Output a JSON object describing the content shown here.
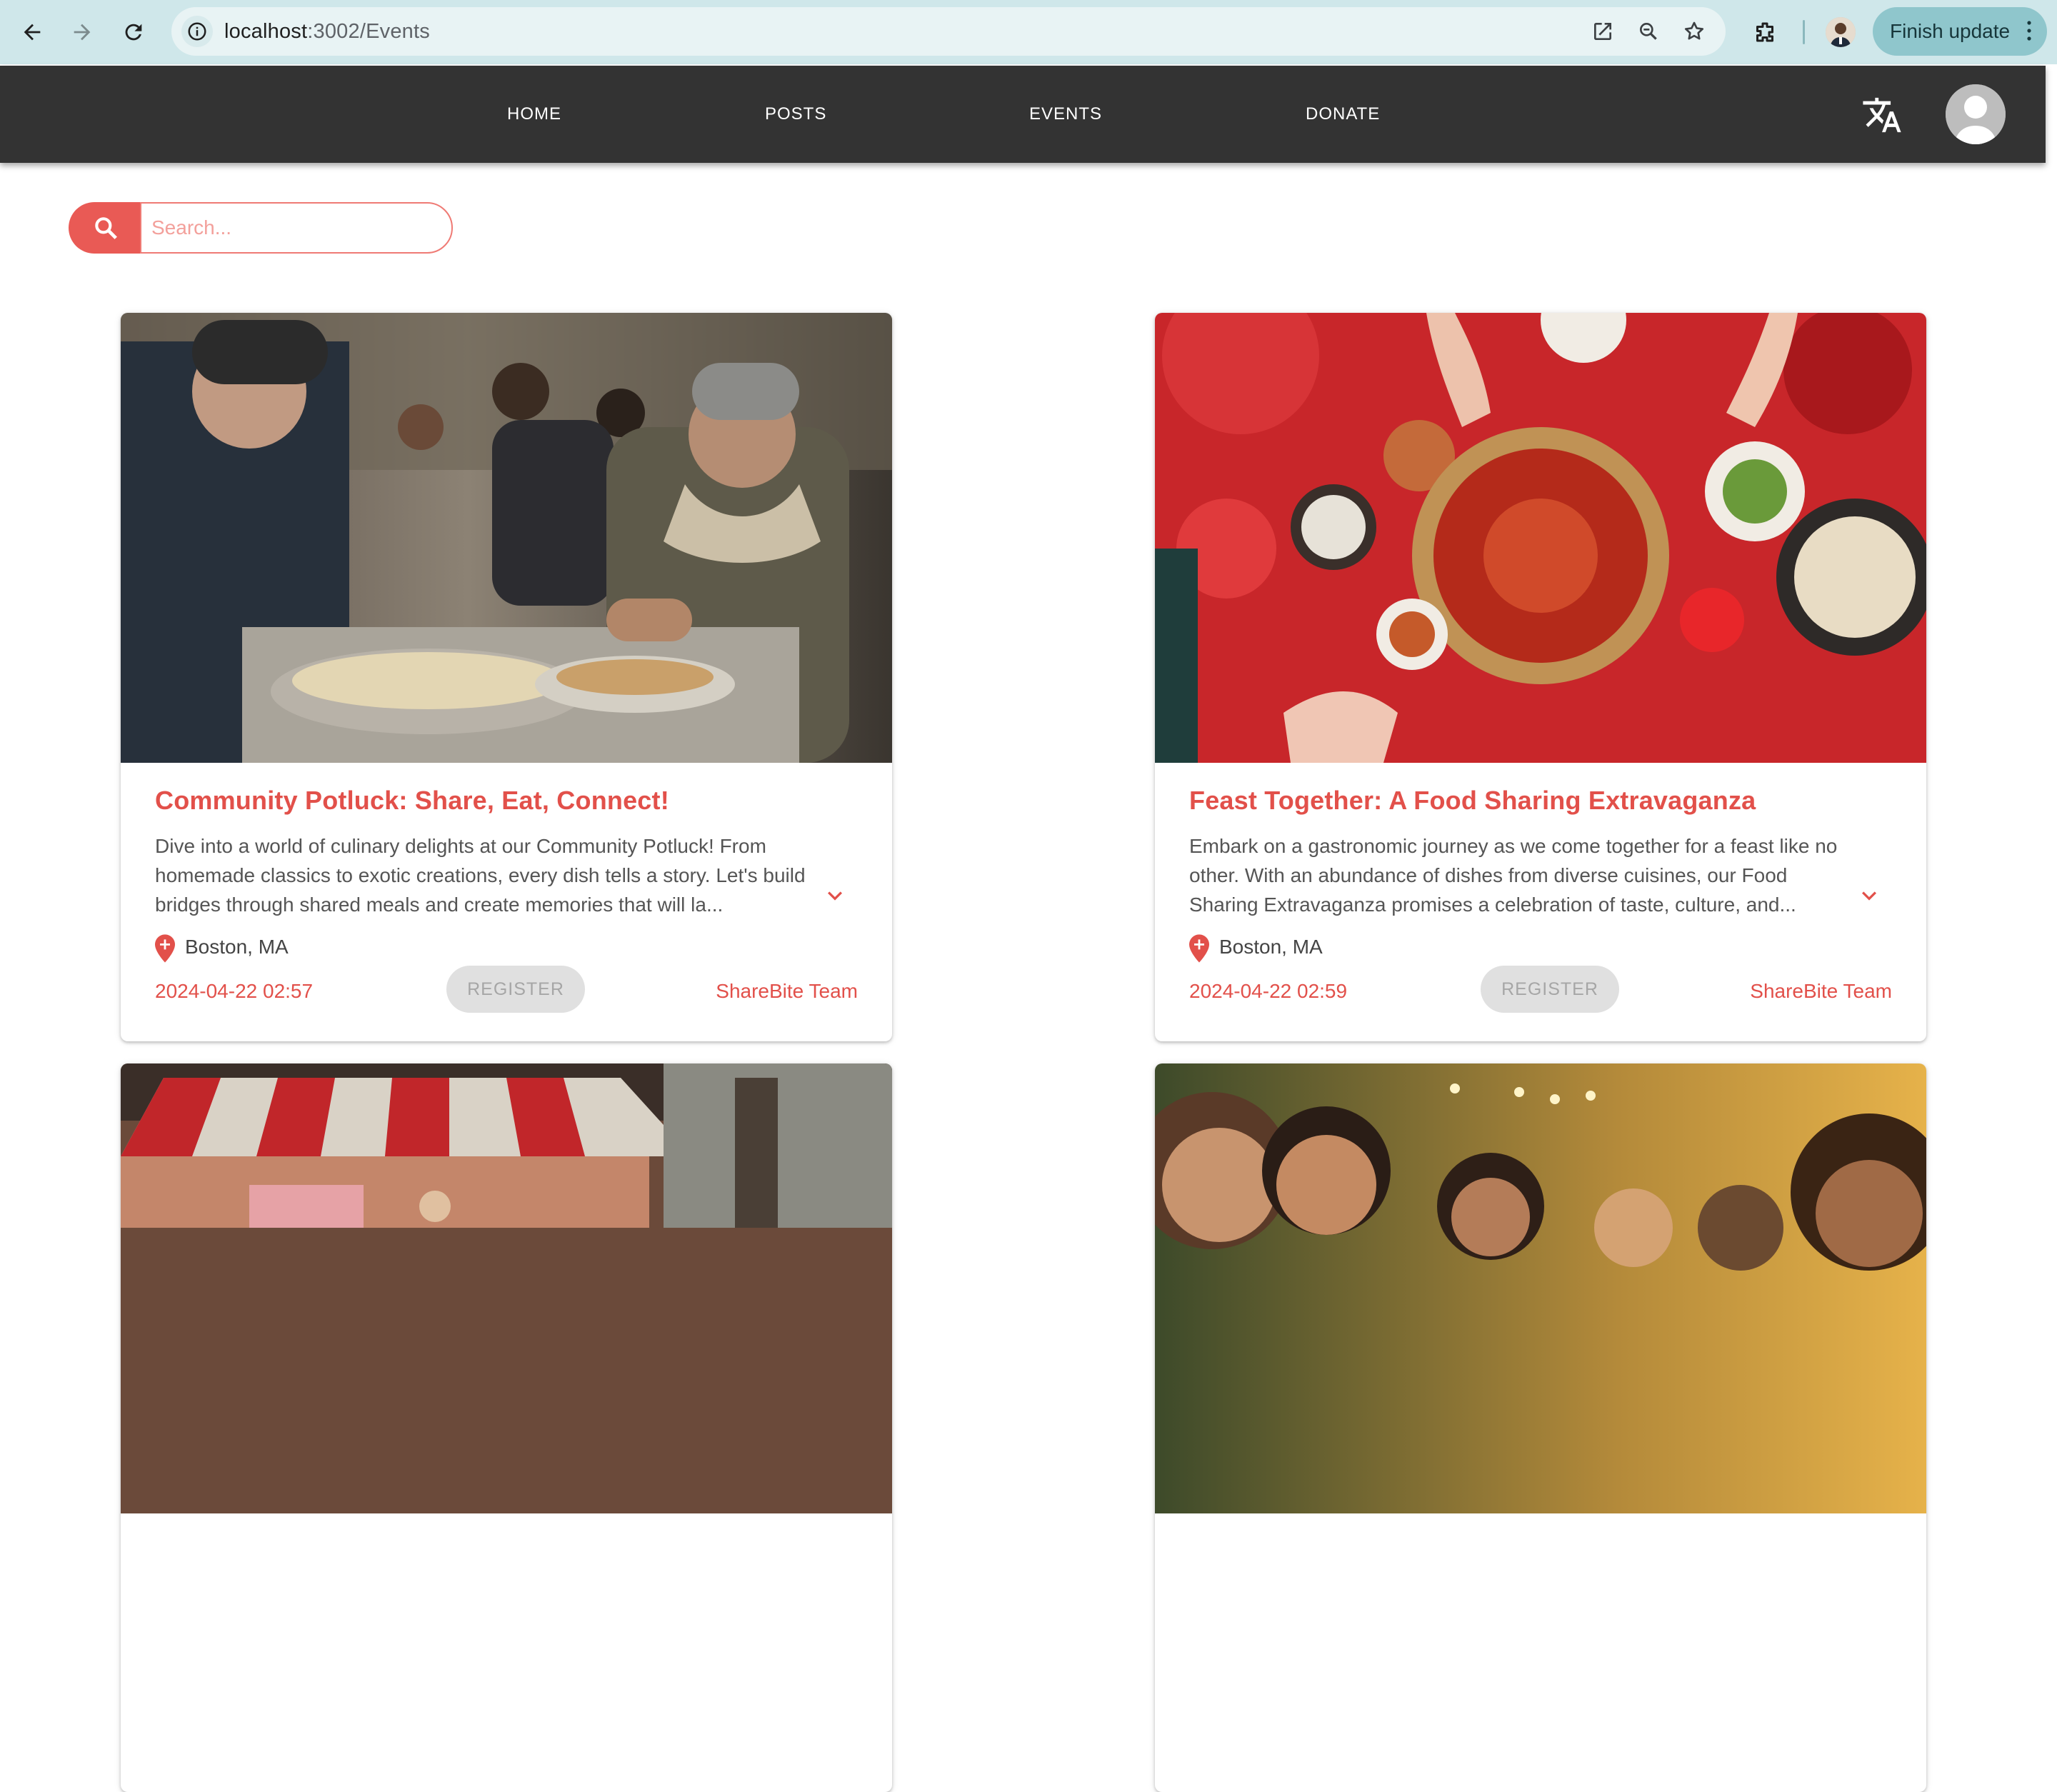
{
  "browser": {
    "url_host": "localhost",
    "url_path": ":3002/Events",
    "finish_update_label": "Finish update"
  },
  "nav": {
    "items": [
      {
        "label": "HOME"
      },
      {
        "label": "POSTS"
      },
      {
        "label": "EVENTS"
      },
      {
        "label": "DONATE"
      }
    ]
  },
  "search": {
    "placeholder": "Search..."
  },
  "events": [
    {
      "title": "Community Potluck: Share, Eat, Connect!",
      "description": "Dive into a world of culinary delights at our Community Potluck! From homemade classics to exotic creations, every dish tells a story. Let's build bridges through shared meals and create memories that will la...",
      "location": "Boston, MA",
      "date": "2024-04-22 02:57",
      "register_label": "REGISTER",
      "organizer": "ShareBite Team"
    },
    {
      "title": "Feast Together: A Food Sharing Extravaganza",
      "description": "Embark on a gastronomic journey as we come together for a feast like no other. With an abundance of dishes from diverse cuisines, our Food Sharing Extravaganza promises a celebration of taste, culture, and...",
      "location": "Boston, MA",
      "date": "2024-04-22 02:59",
      "register_label": "REGISTER",
      "organizer": "ShareBite Team"
    }
  ],
  "colors": {
    "accent": "#e2504a",
    "appbar": "#333333",
    "chrome": "#cfe7ea"
  }
}
